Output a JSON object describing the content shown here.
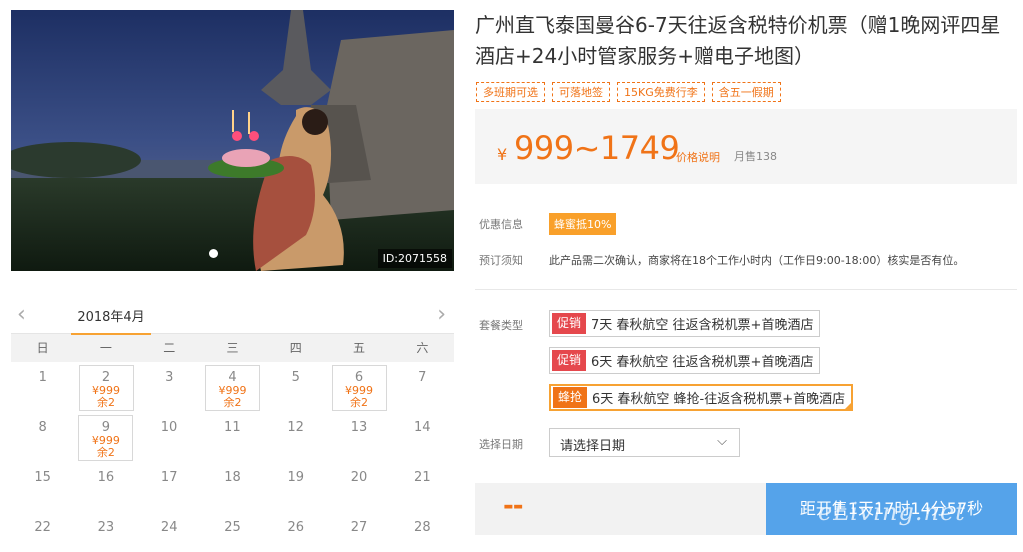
{
  "product": {
    "title": "广州直飞泰国曼谷6-7天往返含税特价机票（赠1晚网评四星酒店+24小时管家服务+赠电子地图）",
    "tags": [
      "多班期可选",
      "可落地签",
      "15KG免费行李",
      "含五一假期"
    ],
    "image_id": "ID:2071558"
  },
  "price": {
    "currency": "¥",
    "range": "999~1749",
    "note_link": "价格说明",
    "sold": "月售138"
  },
  "info": {
    "promo_label": "优惠信息",
    "promo_badge": "蜂蜜抵10%",
    "notice_label": "预订须知",
    "notice_text": "此产品需二次确认，商家将在18个工作小时内（工作日9:00-18:00）核实是否有位。"
  },
  "packages": {
    "label": "套餐类型",
    "items": [
      {
        "badge": "促销",
        "text": "7天 春秋航空 往返含税机票+首晚酒店"
      },
      {
        "badge": "促销",
        "text": "6天 春秋航空 往返含税机票+首晚酒店"
      },
      {
        "badge": "蜂抢",
        "text": "6天 春秋航空 蜂抢-往返含税机票+首晚酒店"
      }
    ]
  },
  "date_select": {
    "label": "选择日期",
    "placeholder": "请选择日期"
  },
  "calendar": {
    "month": "2018年4月",
    "weekdays": [
      "日",
      "一",
      "二",
      "三",
      "四",
      "五",
      "六"
    ],
    "rows": [
      [
        {
          "d": "1"
        },
        {
          "d": "2",
          "p": "¥999",
          "s": "余2"
        },
        {
          "d": "3"
        },
        {
          "d": "4",
          "p": "¥999",
          "s": "余2"
        },
        {
          "d": "5"
        },
        {
          "d": "6",
          "p": "¥999",
          "s": "余2"
        },
        {
          "d": "7"
        }
      ],
      [
        {
          "d": "8"
        },
        {
          "d": "9",
          "p": "¥999",
          "s": "余2"
        },
        {
          "d": "10"
        },
        {
          "d": "11"
        },
        {
          "d": "12"
        },
        {
          "d": "13"
        },
        {
          "d": "14"
        }
      ],
      [
        {
          "d": "15"
        },
        {
          "d": "16"
        },
        {
          "d": "17"
        },
        {
          "d": "18"
        },
        {
          "d": "19"
        },
        {
          "d": "20"
        },
        {
          "d": "21"
        }
      ],
      [
        {
          "d": "22"
        },
        {
          "d": "23"
        },
        {
          "d": "24"
        },
        {
          "d": "25"
        },
        {
          "d": "26"
        },
        {
          "d": "27"
        },
        {
          "d": "28"
        }
      ]
    ]
  },
  "buy": {
    "total": "--",
    "countdown": "距开售1天17时14分57秒"
  },
  "watermark": "eLiving.net",
  "colors": {
    "accent": "#f07317",
    "promo": "#e5484d",
    "button": "#55a3ea"
  }
}
